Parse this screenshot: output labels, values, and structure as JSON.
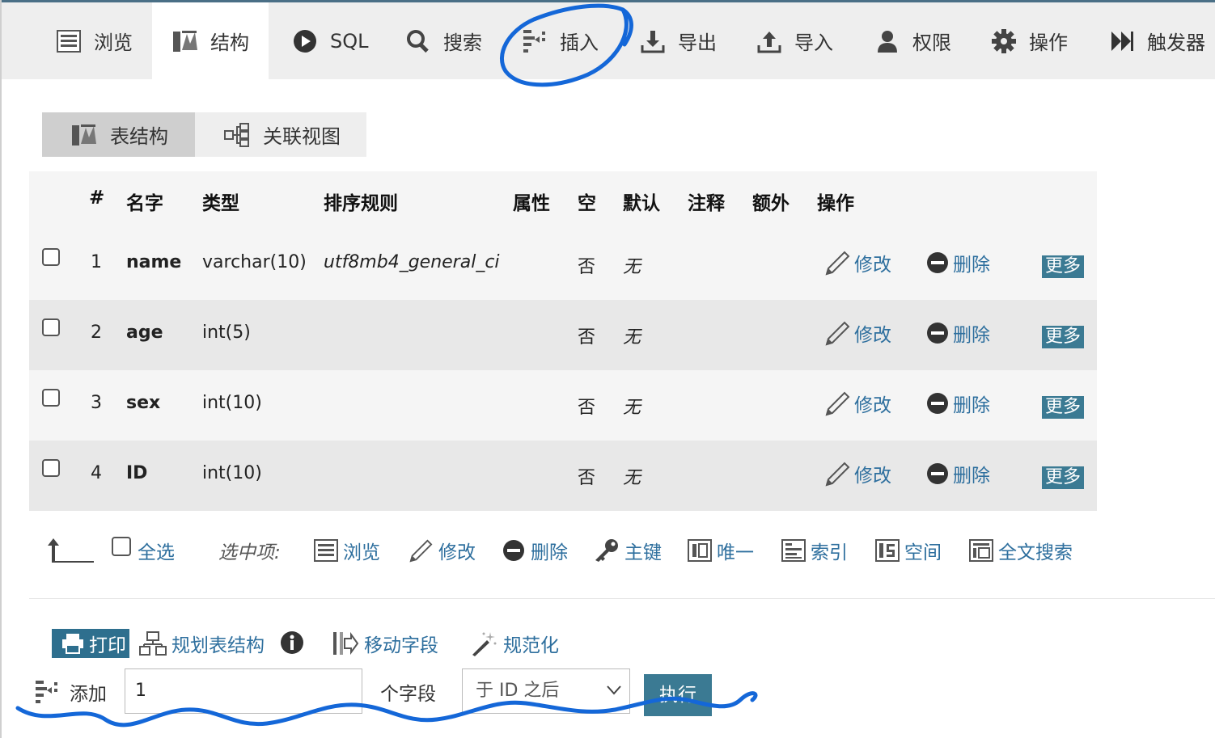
{
  "colors": {
    "link": "#2e6f9e",
    "button_bg": "#3b7a93",
    "annotation": "#1467d8"
  },
  "tabs": [
    {
      "label": "浏览",
      "icon": "browse-icon"
    },
    {
      "label": "结构",
      "icon": "structure-icon",
      "active": true
    },
    {
      "label": "SQL",
      "icon": "sql-icon"
    },
    {
      "label": "搜索",
      "icon": "search-icon"
    },
    {
      "label": "插入",
      "icon": "insert-icon"
    },
    {
      "label": "导出",
      "icon": "export-icon"
    },
    {
      "label": "导入",
      "icon": "import-icon"
    },
    {
      "label": "权限",
      "icon": "user-icon"
    },
    {
      "label": "操作",
      "icon": "gear-icon"
    },
    {
      "label": "触发器",
      "icon": "trigger-icon"
    }
  ],
  "subtabs": {
    "structure": "表结构",
    "relation": "关联视图"
  },
  "table": {
    "headers": {
      "num": "#",
      "name": "名字",
      "type": "类型",
      "collation": "排序规则",
      "attributes": "属性",
      "null": "空",
      "default": "默认",
      "comment": "注释",
      "extra": "额外",
      "action": "操作"
    },
    "rows": [
      {
        "num": "1",
        "name": "name",
        "type": "varchar(10)",
        "collation": "utf8mb4_general_ci",
        "null": "否",
        "default": "无"
      },
      {
        "num": "2",
        "name": "age",
        "type": "int(5)",
        "collation": "",
        "null": "否",
        "default": "无"
      },
      {
        "num": "3",
        "name": "sex",
        "type": "int(10)",
        "collation": "",
        "null": "否",
        "default": "无"
      },
      {
        "num": "4",
        "name": "ID",
        "type": "int(10)",
        "collation": "",
        "null": "否",
        "default": "无"
      }
    ],
    "row_actions": {
      "edit": "修改",
      "drop": "删除",
      "more": "更多"
    }
  },
  "bulk": {
    "select_all": "全选",
    "with_selected": "选中项:",
    "browse": "浏览",
    "edit": "修改",
    "drop": "删除",
    "primary": "主键",
    "unique": "唯一",
    "index": "索引",
    "spatial": "空间",
    "fulltext": "全文搜索"
  },
  "tools": {
    "print": "打印",
    "propose": "规划表结构",
    "move": "移动字段",
    "normalize": "规范化"
  },
  "add": {
    "label": "添加",
    "count": "1",
    "suffix": "个字段",
    "position": "于 ID 之后",
    "go": "执行"
  }
}
